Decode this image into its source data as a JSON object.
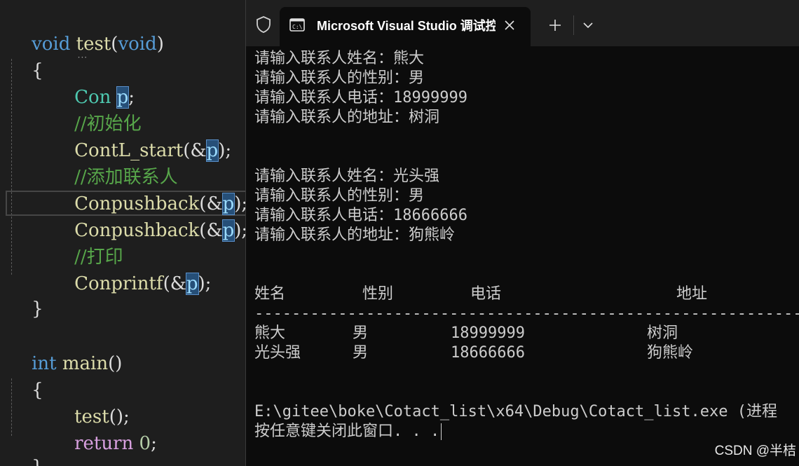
{
  "editor": {
    "lines": [
      {
        "void1": "void",
        "fname": "test",
        "lp": "(",
        "void2": "void",
        "rp": ")"
      },
      {
        "brace": "{"
      },
      {
        "type": "Con",
        "var": "p",
        "semi": ";"
      },
      {
        "comment": "//初始化"
      },
      {
        "fn": "ContL_start",
        "lp": "(&",
        "var": "p",
        "rp": ");"
      },
      {
        "comment": "//添加联系人"
      },
      {
        "fn": "Conpushback",
        "lp": "(&",
        "var": "p",
        "rp": ");"
      },
      {
        "fn": "Conpushback",
        "lp": "(&",
        "var": "p",
        "rp": ");"
      },
      {
        "comment": "//打印"
      },
      {
        "fn": "Conprintf",
        "lp": "(&",
        "var": "p",
        "rp": ");"
      },
      {
        "brace": "}"
      },
      {
        "kw": "int",
        "fn": "main",
        "parens": "()"
      },
      {
        "brace": "{"
      },
      {
        "fn": "test",
        "rest": "();"
      },
      {
        "kw": "return",
        "num": "0",
        "semi": ";"
      },
      {
        "brace": "}"
      }
    ]
  },
  "terminal": {
    "tab_title": "Microsoft Visual Studio 调试控制台",
    "icons": {
      "shield": "shield-icon",
      "tab": "console-icon",
      "close": "close-icon",
      "new_tab": "plus-icon",
      "dropdown": "chevron-down-icon"
    },
    "output": [
      "请输入联系人姓名：熊大",
      "请输入联系人的性别：男",
      "请输入联系人电话：18999999",
      "请输入联系人的地址：树洞",
      "请输入联系人姓名：光头强",
      "请输入联系人的性别：男",
      "请输入联系人电话：18666666",
      "请输入联系人的地址：狗熊岭"
    ],
    "table": {
      "headers": [
        "姓名",
        "性别",
        "电话",
        "地址"
      ],
      "separator": "------------------------------------------------------------------------",
      "rows": [
        [
          "熊大",
          "男",
          "18999999",
          "树洞"
        ],
        [
          "光头强",
          "男",
          "18666666",
          "狗熊岭"
        ]
      ]
    },
    "exit_line": "E:\\gitee\\boke\\Cotact_list\\x64\\Debug\\Cotact_list.exe (进程",
    "press_key_line": "按任意键关闭此窗口. . ."
  },
  "watermark": "CSDN @半桔",
  "colors": {
    "editor_bg": "#1e1e1e",
    "terminal_bg": "#0c0c0c",
    "titlebar_bg": "#1f1f1f",
    "keyword": "#569cd6",
    "function": "#dcdcaa",
    "comment": "#57a64a",
    "type": "#4ec9b0"
  }
}
